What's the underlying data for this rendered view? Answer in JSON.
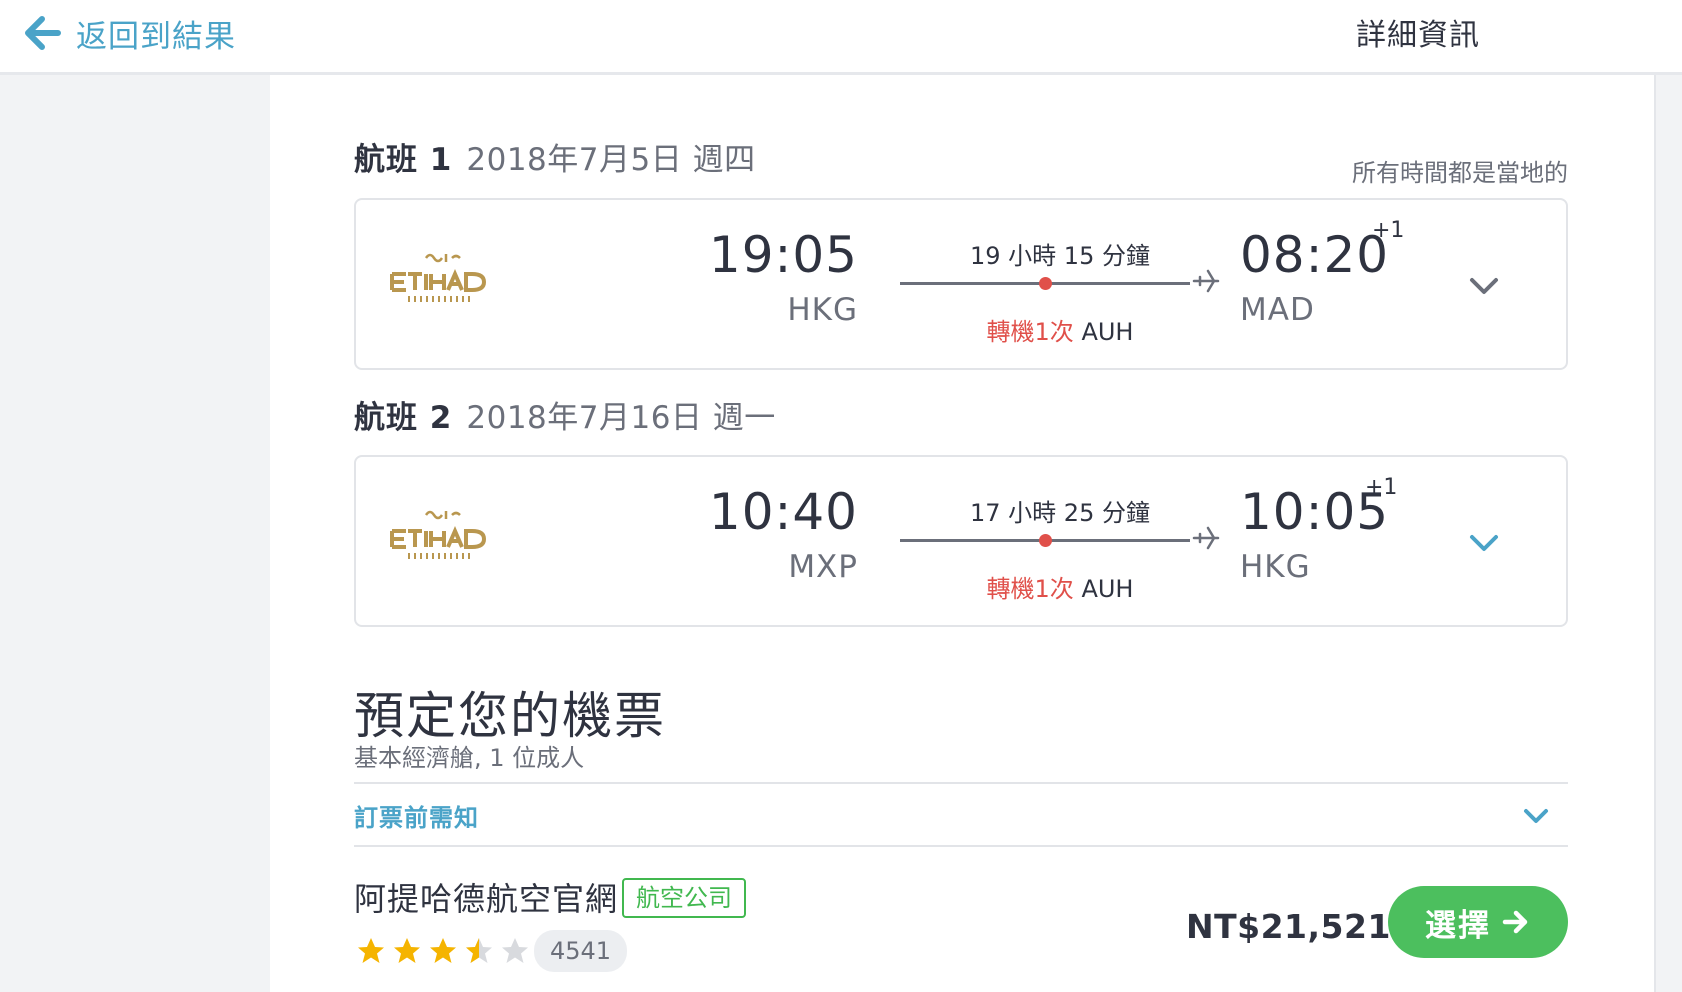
{
  "header": {
    "back_label": "返回到結果",
    "title": "詳細資訊"
  },
  "timezone_note": "所有時間都是當地的",
  "flights": [
    {
      "label": "航班 1",
      "date": "2018年7月5日 週四",
      "airline": "Etihad Airways",
      "dep_time": "19:05",
      "dep_code": "HKG",
      "duration": "19 小時 15 分鐘",
      "stops": "轉機1次",
      "via": "AUH",
      "arr_time": "08:20",
      "arr_plus": "+1",
      "arr_code": "MAD",
      "chevron_color": "#6b6f7a"
    },
    {
      "label": "航班 2",
      "date": "2018年7月16日 週一",
      "airline": "Etihad Airways",
      "dep_time": "10:40",
      "dep_code": "MXP",
      "duration": "17 小時 25 分鐘",
      "stops": "轉機1次",
      "via": "AUH",
      "arr_time": "10:05",
      "arr_plus": "+1",
      "arr_code": "HKG",
      "chevron_color": "#4aa3c8"
    }
  ],
  "booking": {
    "title": "預定您的機票",
    "subtitle": "基本經濟艙, 1 位成人",
    "notice_label": "訂票前需知",
    "vendor_name": "阿提哈德航空官網",
    "vendor_badge": "航空公司",
    "rating": 3.5,
    "rating_max": 5,
    "review_count": "4541",
    "price": "NT$21,521",
    "select_label": "選擇"
  },
  "colors": {
    "accent_blue": "#4aa3c8",
    "stop_red": "#e0504a",
    "button_green": "#4cbf5e",
    "star_gold": "#f5b400",
    "etihad_gold": "#b9974f"
  }
}
